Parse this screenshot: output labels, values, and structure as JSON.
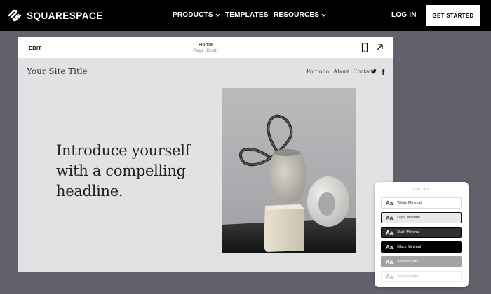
{
  "topnav": {
    "logo_text": "SQUARESPACE",
    "links": [
      "PRODUCTS",
      "TEMPLATES",
      "RESOURCES"
    ],
    "login": "LOG IN",
    "get_started": "GET STARTED"
  },
  "editor": {
    "edit_label": "EDIT",
    "page_name": "Home",
    "page_status": "Page (Draft)"
  },
  "site": {
    "title": "Your Site Title",
    "nav": [
      "Portfolio",
      "About",
      "Contact"
    ],
    "social": {
      "twitter": "𝕥",
      "facebook": "f"
    },
    "headline": "Introduce yourself with a compelling headline."
  },
  "colors_panel": {
    "title": "COLORS",
    "swatch_glyph": "Aa",
    "swatches": [
      {
        "name": "White Minimal",
        "bg": "#ffffff",
        "fg": "#333333",
        "border": "#dddddd"
      },
      {
        "name": "Light Minimal",
        "bg": "#e9eaeb",
        "fg": "#333333",
        "border": "#111111"
      },
      {
        "name": "Dark Minimal",
        "bg": "#2f2f2f",
        "fg": "#ffffff",
        "border": "#000000"
      },
      {
        "name": "Black Minimal",
        "bg": "#000000",
        "fg": "#ffffff",
        "border": "#000000"
      },
      {
        "name": "Accent Dark",
        "bg": "#a3a3a3",
        "fg": "#ffffff",
        "border": "#a3a3a3"
      },
      {
        "name": "Accent Light",
        "bg": "#ffffff",
        "fg": "#bbbbbb",
        "border": "#eeeeee"
      }
    ]
  },
  "icons": [
    "squarespace-logo-icon",
    "chevron-down-icon",
    "mobile-preview-icon",
    "open-external-icon",
    "twitter-icon",
    "facebook-icon"
  ]
}
